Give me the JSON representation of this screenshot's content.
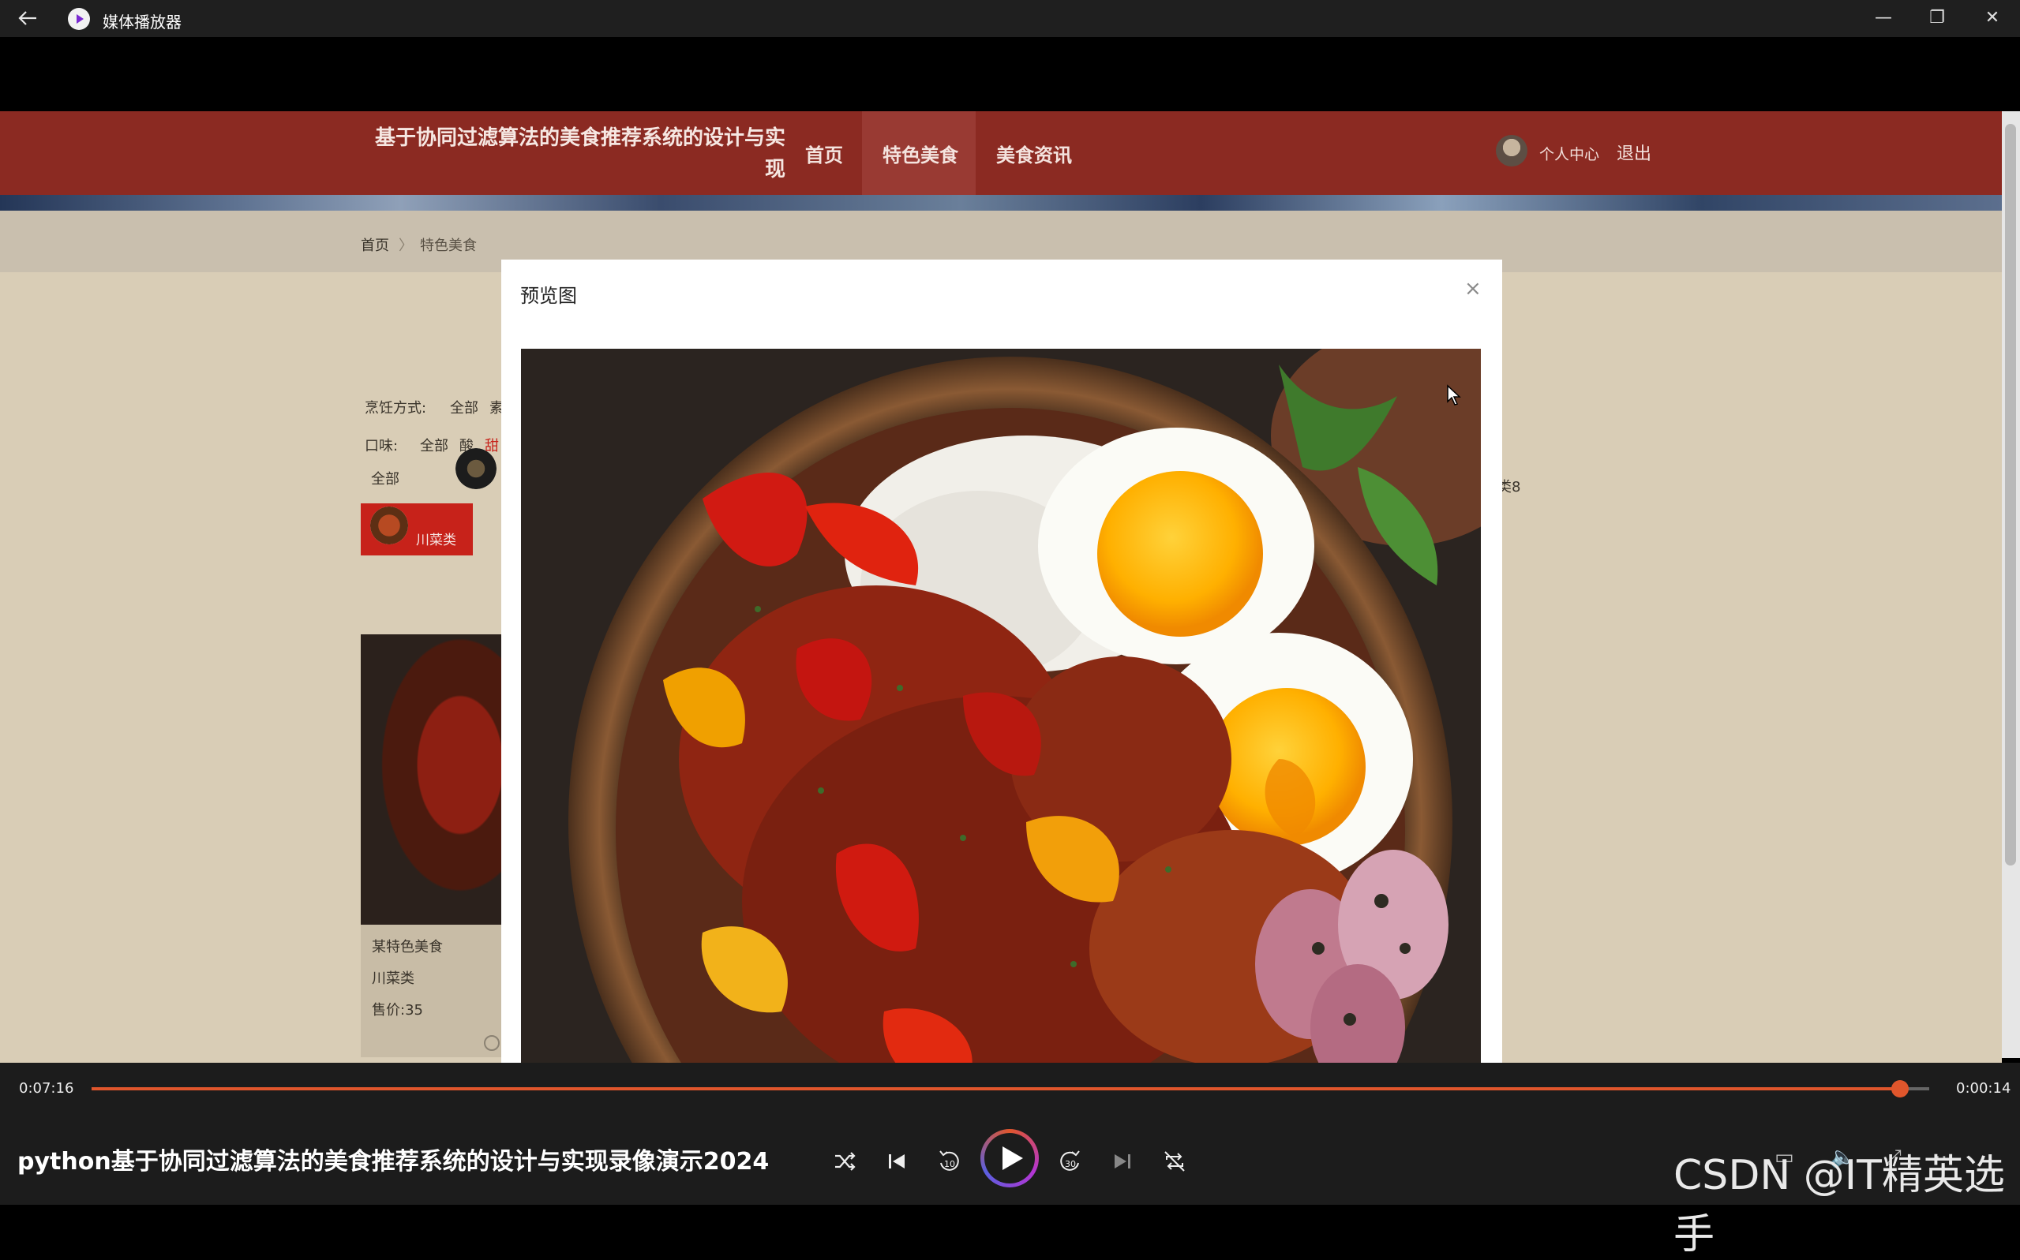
{
  "window": {
    "title": "媒体播放器",
    "controls": [
      "—",
      "❐",
      "✕"
    ]
  },
  "site": {
    "title": "基于协同过滤算法的美食推荐系统的设计与实现",
    "nav": [
      "首页",
      "特色美食",
      "美食资讯"
    ],
    "personal_center": "个人中心",
    "logout": "退出",
    "breadcrumb": {
      "home": "首页",
      "separator": "〉",
      "current": "特色美食"
    },
    "filters": {
      "cooking_label": "烹饪方式:",
      "cooking_all": "全部",
      "cooking_more": "素",
      "taste_label": "口味:",
      "taste_all": "全部",
      "taste_sour": "酸",
      "taste_sweet": "甜"
    },
    "category_all": "全部",
    "category_selected": "川菜类",
    "side_text": "类8",
    "card": {
      "name": "某特色美食",
      "category": "川菜类",
      "price": "售价:35"
    }
  },
  "modal": {
    "title": "预览图",
    "close": "×"
  },
  "player": {
    "elapsed": "0:07:16",
    "remaining": "0:00:14",
    "progress_fraction": 0.984,
    "video_title": "python基于协同过滤算法的美食推荐系统的设计与实现录像演示2024",
    "watermark": "CSDN @IT精英选手"
  },
  "colors": {
    "header": "#8b2a22",
    "accent": "#e0562c",
    "selected_category": "#c7221a"
  }
}
